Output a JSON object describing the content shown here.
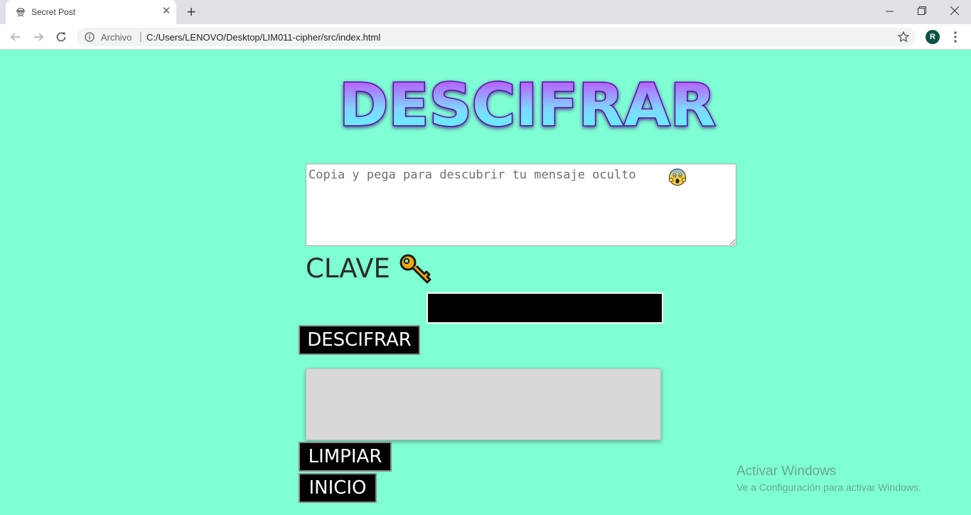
{
  "browser": {
    "tab_title": "Secret Post",
    "tab_close": "✕",
    "new_tab": "+",
    "address_scheme": "Archivo",
    "address_separator": "|",
    "address_url": "C:/Users/LENOVO/Desktop/LIM011-cipher/src/index.html",
    "profile_initial": "R"
  },
  "page": {
    "heading": "DESCIFRAR",
    "message_placeholder": "Copia y pega para descubrir tu mensaje oculto",
    "key_label": "CLAVE",
    "key_value": "",
    "decipher_button": "DESCIFRAR",
    "output_text": "",
    "clear_button": "LIMPIAR",
    "home_button": "INICIO"
  },
  "watermark": {
    "title": "Activar Windows",
    "subtitle": "Ve a Configuración para activar Windows."
  },
  "colors": {
    "background": "#7fffd4",
    "heading_top": "#cc33ff",
    "heading_bottom": "#55ffff",
    "heading_outline": "#5a0fa8",
    "button_bg": "#000000",
    "output_bg": "#d8d8d8"
  },
  "icons": {
    "favicon": "spy-icon",
    "message_emoji": "screaming-face-icon",
    "key": "key-icon"
  }
}
